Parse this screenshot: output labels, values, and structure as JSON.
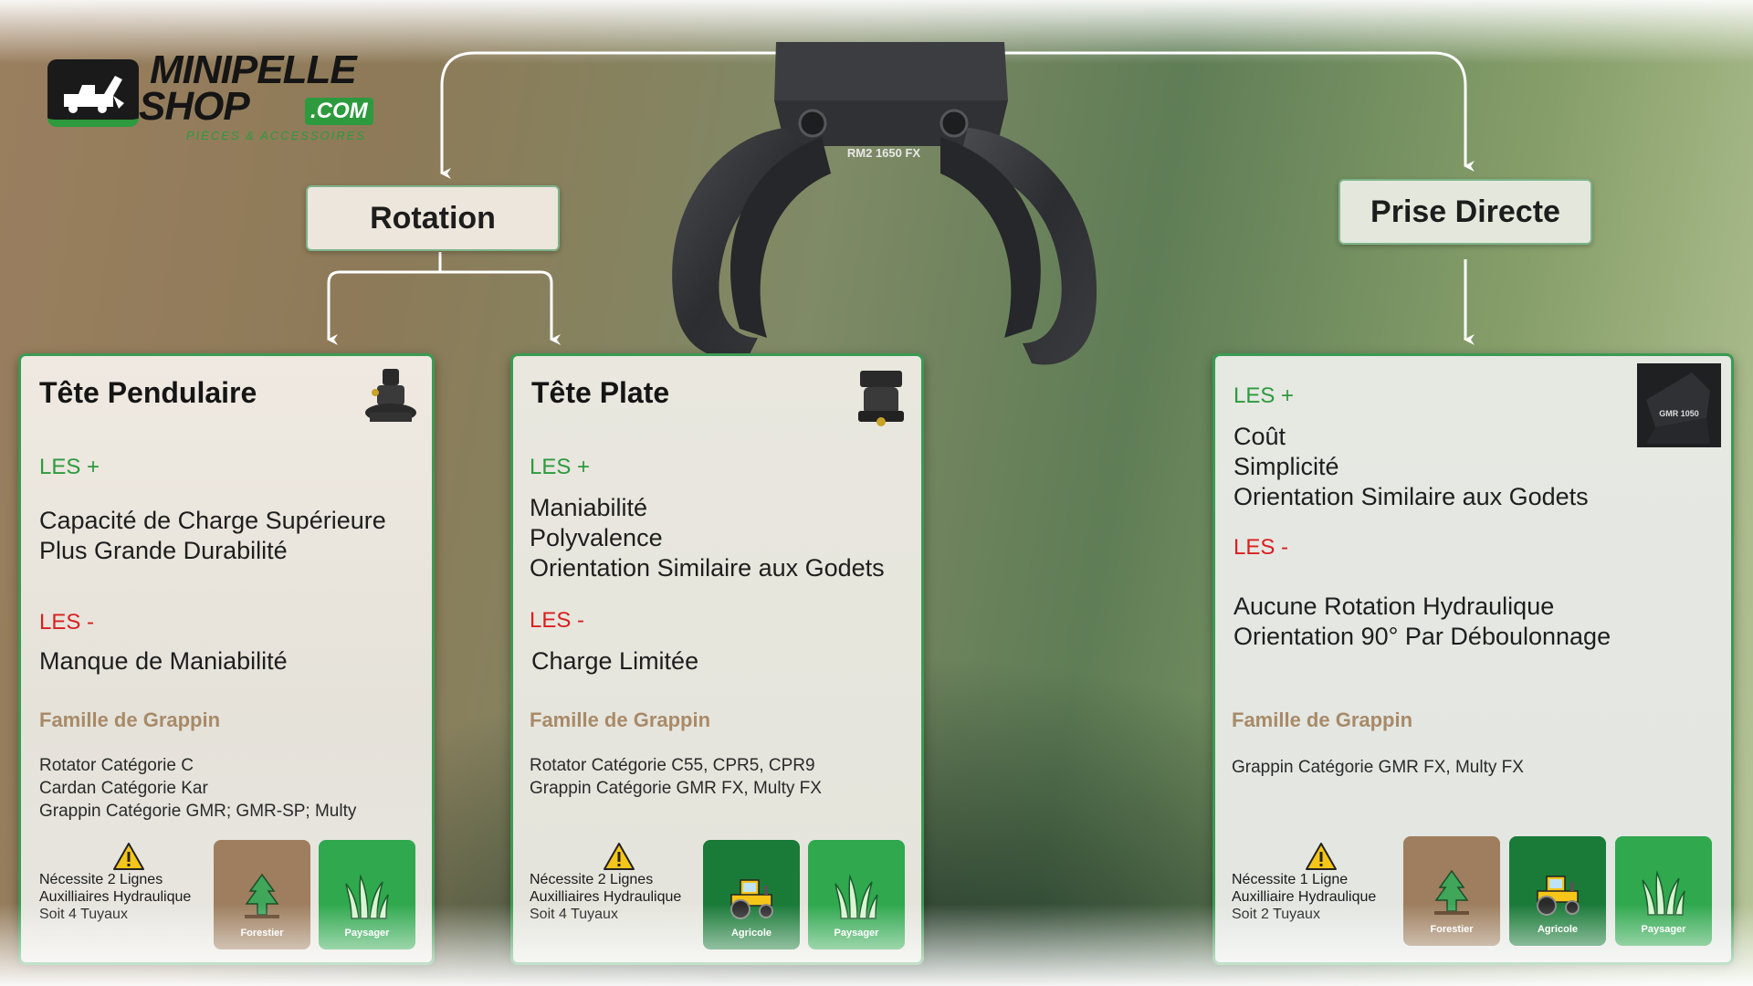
{
  "logo": {
    "line1": "MINIPELLE",
    "line2": "SHOP",
    "com": ".COM",
    "tagline": "PIÈCES & ACCESSOIRES"
  },
  "grapple_model": "RM2 1650 FX",
  "branches": {
    "rotation": "Rotation",
    "prise": "Prise Directe"
  },
  "cards": {
    "pendulaire": {
      "title": "Tête Pendulaire",
      "plus_label": "LES +",
      "plus": [
        "Capacité de Charge Supérieure",
        "Plus Grande Durabilité"
      ],
      "minus_label": "LES -",
      "minus": [
        "Manque de Maniabilité"
      ],
      "family_label": "Famille de Grappin",
      "family": [
        "Rotator Catégorie C",
        "Cardan Catégorie Kar",
        "Grappin Catégorie GMR; GMR-SP; Multy"
      ],
      "warning": [
        "Nécessite 2 Lignes",
        "Auxilliaires Hydraulique",
        "Soit 4 Tuyaux"
      ],
      "usages": [
        "Forestier",
        "Paysager"
      ]
    },
    "plate": {
      "title": "Tête Plate",
      "plus_label": "LES +",
      "plus": [
        "Maniabilité",
        "Polyvalence",
        "Orientation Similaire aux Godets"
      ],
      "minus_label": "LES -",
      "minus": [
        "Charge Limitée"
      ],
      "family_label": "Famille de Grappin",
      "family": [
        "Rotator Catégorie C55, CPR5, CPR9",
        "Grappin Catégorie GMR FX, Multy FX"
      ],
      "warning": [
        "Nécessite 2 Lignes",
        "Auxilliaires Hydraulique",
        "Soit 4 Tuyaux"
      ],
      "usages": [
        "Agricole",
        "Paysager"
      ]
    },
    "prise": {
      "plus_label": "LES +",
      "plus": [
        "Coût",
        "Simplicité",
        "Orientation Similaire aux Godets"
      ],
      "minus_label": "LES -",
      "minus": [
        "Aucune Rotation Hydraulique",
        "Orientation 90° Par Déboulonnage"
      ],
      "family_label": "Famille de Grappin",
      "family": [
        "Grappin Catégorie GMR FX, Multy FX"
      ],
      "warning": [
        "Nécessite 1 Ligne",
        "Auxilliaire Hydraulique",
        "Soit 2 Tuyaux"
      ],
      "usages": [
        "Forestier",
        "Agricole",
        "Paysager"
      ],
      "thumb_label": "GMR 1050"
    }
  },
  "colors": {
    "accent_green": "#2d9a3e",
    "minus_red": "#d91f1f",
    "family_brown": "#a88a68",
    "forest_tile": "#9e7e5e",
    "agri_tile": "#1a7a38",
    "landscape_tile": "#2fa84e"
  }
}
